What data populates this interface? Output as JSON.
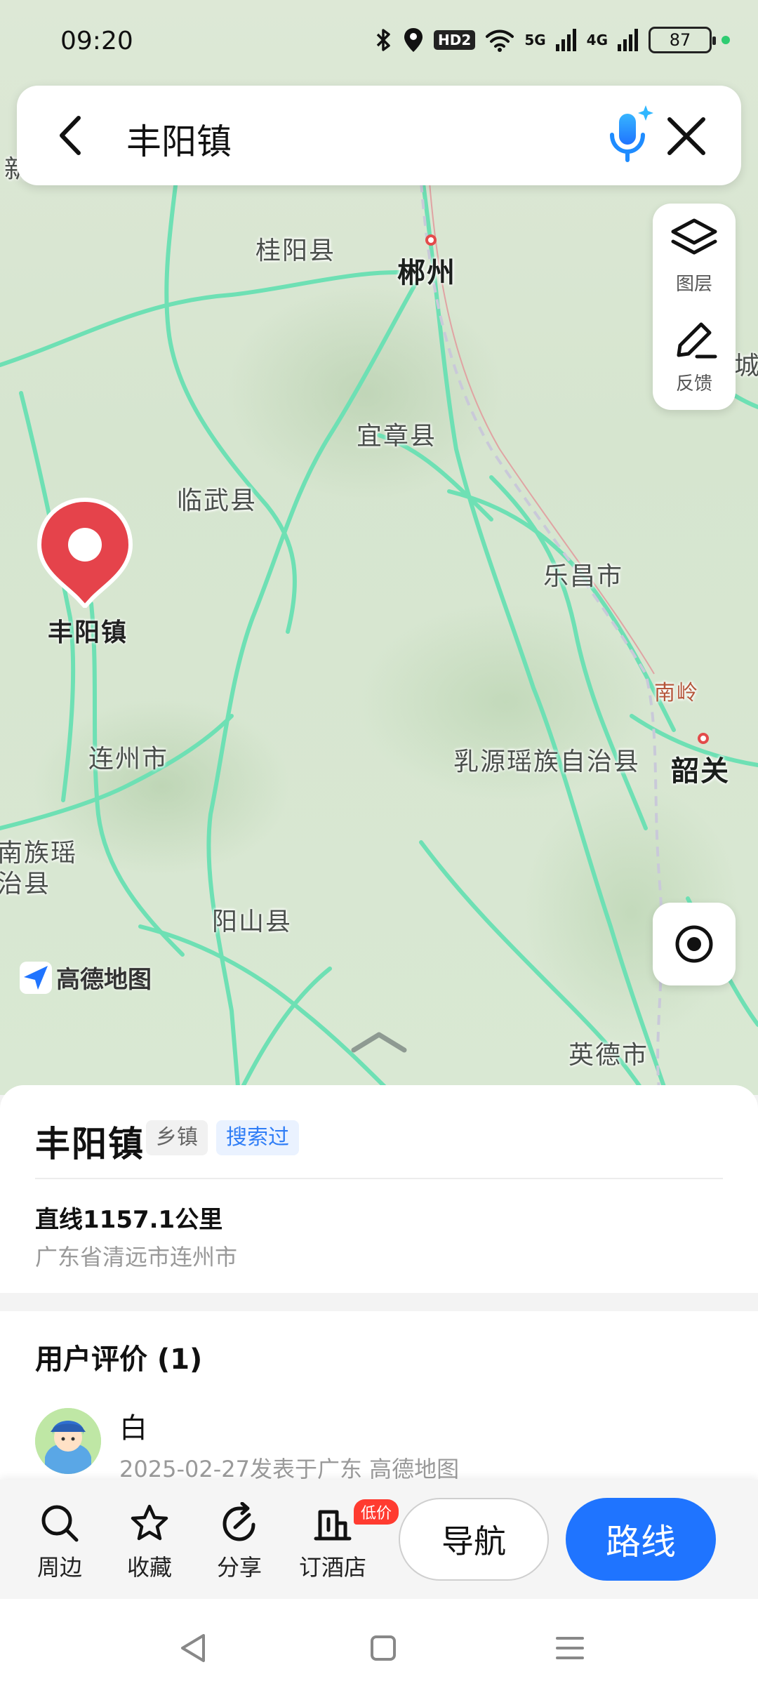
{
  "status_bar": {
    "time": "09:20",
    "battery": "87",
    "icons": [
      "bluetooth-icon",
      "location-icon",
      "hd-icon",
      "wifi-icon",
      "signal-5g-icon",
      "signal-4g-icon",
      "battery-icon"
    ],
    "hd_label": "HD2",
    "net1": "5G",
    "net2": "4G"
  },
  "search": {
    "query": "丰阳镇"
  },
  "map": {
    "places": {
      "guiyang": "桂阳县",
      "chenzhou": "郴州",
      "yizhang": "宜章县",
      "linwu": "临武县",
      "lechang": "乐昌市",
      "nanling": "南岭",
      "shaoguan": "韶关",
      "ruyuan": "乳源瑶族自治县",
      "lianzhou": "连州市",
      "liannan1": "南族瑶",
      "liannan2": "治县",
      "yangshan": "阳山县",
      "yingde": "英德市",
      "edge_left": "新",
      "edge_right": "城"
    },
    "pin_label": "丰阳镇",
    "logo": "高德地图",
    "layer_label": "图层",
    "feedback_label": "反馈"
  },
  "sheet": {
    "title": "丰阳镇",
    "tag_type": "乡镇",
    "tag_searched": "搜索过",
    "distance": "直线1157.1公里",
    "address": "广东省清远市连州市",
    "reviews_title": "用户评价 (1)",
    "review_user": "白",
    "review_meta": "2025-02-27发表于广东  高德地图"
  },
  "actions": {
    "nearby": "周边",
    "favorite": "收藏",
    "share": "分享",
    "hotel": "订酒店",
    "hotel_badge": "低价",
    "navigate": "导航",
    "route": "路线"
  },
  "colors": {
    "accent": "#1f74ff",
    "pin": "#e5434b",
    "road": "#5fd6a8"
  }
}
